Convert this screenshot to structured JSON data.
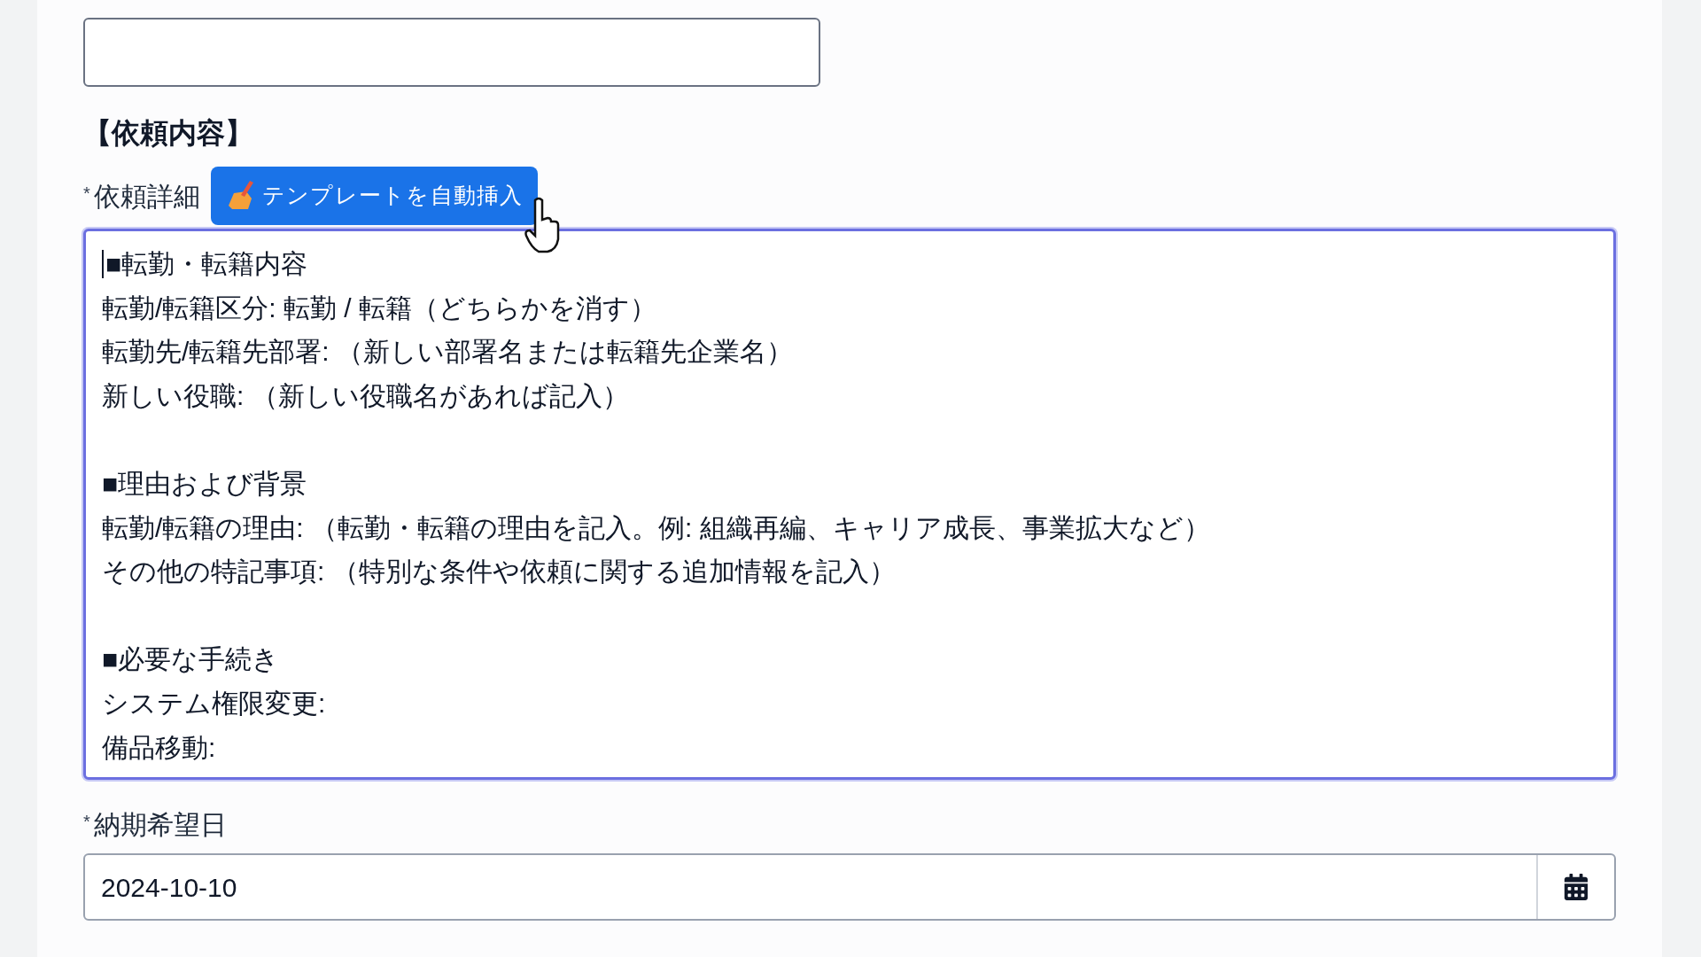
{
  "section_title": "【依頼内容】",
  "detail": {
    "label": "依頼詳細",
    "required_mark": "*",
    "template_button": "テンプレートを自動挿入",
    "focused": true,
    "sections": [
      {
        "lines": [
          "■転勤・転籍内容",
          "転勤/転籍区分: 転勤 / 転籍（どちらかを消す）",
          "転勤先/転籍先部署: （新しい部署名または転籍先企業名）",
          "新しい役職: （新しい役職名があれば記入）"
        ]
      },
      {
        "lines": [
          "■理由および背景",
          "転勤/転籍の理由: （転勤・転籍の理由を記入。例: 組織再編、キャリア成長、事業拡大など）",
          "その他の特記事項: （特別な条件や依頼に関する追加情報を記入）"
        ]
      },
      {
        "lines": [
          "■必要な手続き",
          "システム権限変更:",
          "備品移動:"
        ]
      }
    ]
  },
  "due_date": {
    "label": "納期希望日",
    "required_mark": "*",
    "value": "2024-10-10"
  }
}
